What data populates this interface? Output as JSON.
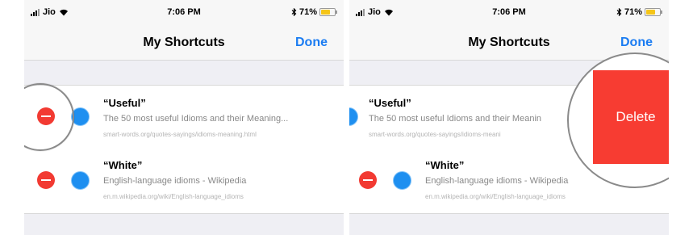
{
  "status_bar": {
    "carrier_left": "Jio",
    "carrier_right": "Jio",
    "time": "7:06 PM",
    "battery": "71%",
    "battery_level": 0.71
  },
  "nav": {
    "title": "My Shortcuts",
    "done_label": "Done"
  },
  "shortcuts": [
    {
      "title": "“Useful”",
      "description": "The 50 most useful Idioms and their Meaning...",
      "description_truncated": "The 50 most useful Idioms and their Meanin",
      "url": "smart-words.org/quotes-sayings/idioms-meaning.html",
      "url_truncated": "smart-words.org/quotes-sayings/idioms-meani"
    },
    {
      "title": "“White”",
      "description": "English-language idioms - Wikipedia",
      "url": "en.m.wikipedia.org/wiki/English-language_idioms"
    }
  ],
  "delete_label": "Delete",
  "colors": {
    "accent": "#1b7cf2",
    "delete": "#f73c32",
    "minus": "#f23a32",
    "battery": "#f5c518"
  }
}
